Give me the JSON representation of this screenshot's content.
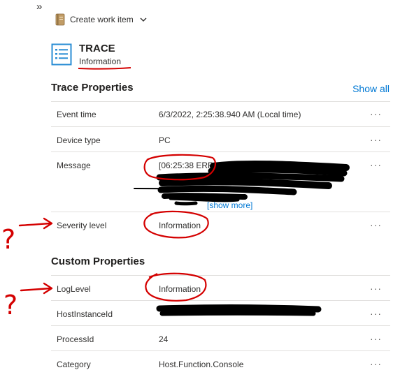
{
  "nav": {
    "expand_label": "»"
  },
  "toolbar": {
    "create_work_item_label": "Create work item"
  },
  "header": {
    "title": "TRACE",
    "subtitle": "Information"
  },
  "trace_section": {
    "title": "Trace Properties",
    "show_all_label": "Show all",
    "rows": [
      {
        "label": "Event time",
        "value": "6/3/2022, 2:25:38.940 AM (Local time)"
      },
      {
        "label": "Device type",
        "value": "PC"
      },
      {
        "label": "Message",
        "value": "[06:25:38 ERR]",
        "show_more_label": "[show more]"
      },
      {
        "label": "Severity level",
        "value": "Information"
      }
    ]
  },
  "custom_section": {
    "title": "Custom Properties",
    "rows": [
      {
        "label": "LogLevel",
        "value": "Information"
      },
      {
        "label": "HostInstanceId",
        "value": ""
      },
      {
        "label": "ProcessId",
        "value": "24"
      },
      {
        "label": "Category",
        "value": "Host.Function.Console"
      }
    ]
  },
  "row_menu_label": "···",
  "annotations": {
    "question_mark": "?"
  },
  "colors": {
    "accent_blue": "#0078d4",
    "annotation_red": "#d40000",
    "redaction_black": "#000000"
  }
}
